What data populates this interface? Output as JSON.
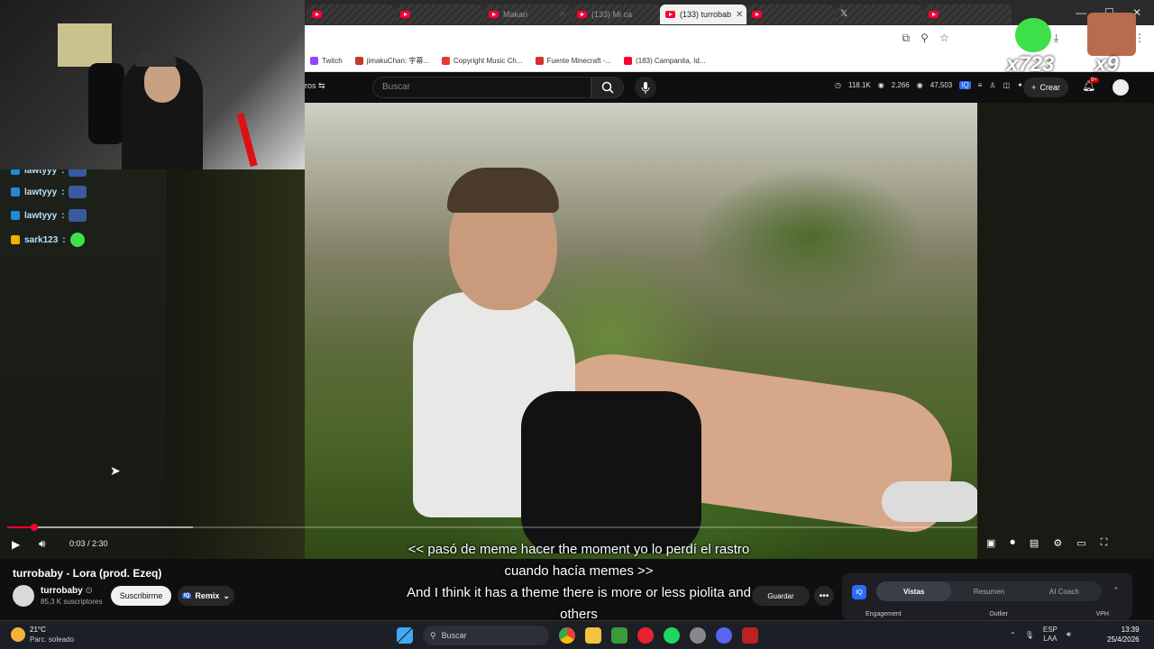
{
  "browser": {
    "tabs": [
      {
        "label": "",
        "icon": "youtube-icon"
      },
      {
        "label": "",
        "icon": "youtube-icon"
      },
      {
        "label": "Makari",
        "icon": "youtube-icon"
      },
      {
        "label": "(133) Mi ca",
        "icon": "youtube-icon"
      },
      {
        "label": "(133) turrobab",
        "icon": "youtube-icon",
        "active": true
      },
      {
        "label": "",
        "icon": "youtube-icon"
      },
      {
        "label": "",
        "icon": "x-icon"
      },
      {
        "label": "",
        "icon": "youtube-icon"
      }
    ],
    "bookmarks": [
      {
        "label": "Twitch",
        "color": "#9146ff"
      },
      {
        "label": "jimakuChan: 字幕...",
        "color": "#c0392b"
      },
      {
        "label": "Copyright Music Ch...",
        "color": "#e53935"
      },
      {
        "label": "Fuente Minecraft -...",
        "color": "#d32f2f"
      },
      {
        "label": "(183) Campanita, Id...",
        "color": "#ff0033"
      }
    ]
  },
  "youtube": {
    "menu_fragment": "ros",
    "search_placeholder": "Buscar",
    "stats": [
      "118.1K",
      "2,266",
      "47,503"
    ],
    "create_label": "Crear",
    "notif_badge": "9+"
  },
  "overlay": {
    "chat": [
      {
        "user": "lawtyyy",
        "emote": "car"
      },
      {
        "user": "lawtyyy",
        "emote": "car"
      },
      {
        "user": "sark123",
        "emote": "green-blob"
      }
    ],
    "emote_counters": [
      {
        "name": "green-blob",
        "count": "x723"
      },
      {
        "name": "face",
        "count": "x9"
      }
    ]
  },
  "player": {
    "time": "0:03 / 2:30",
    "progress_fraction": 0.02,
    "subtitles": [
      "<< pasó de meme hacer the moment yo lo perdí el rastro",
      "cuando hacía memes >>",
      "And I think it has a theme there is more or less piolita and",
      "others"
    ]
  },
  "video": {
    "title": "turrobaby - Lora (prod. Ezeq)",
    "channel": "turrobaby",
    "subscribers": "85,3 K suscriptores",
    "subscribe_label": "Suscribirme",
    "remix_label": "Remix",
    "save_label": "Guardar"
  },
  "vidiq": {
    "tabs": [
      "Vistas",
      "Resumen",
      "AI Coach"
    ],
    "metrics": [
      "Engagement",
      "Outlier",
      "VPH"
    ]
  },
  "taskbar": {
    "temp": "21°C",
    "weather": "Parc. soleado",
    "search": "Buscar",
    "lang1": "ESP",
    "lang2": "LAA",
    "time": "13:39",
    "date": "25/4/2026"
  }
}
